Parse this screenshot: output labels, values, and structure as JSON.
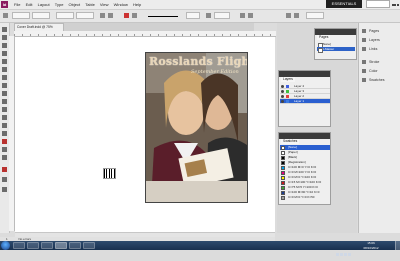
{
  "menubar": {
    "logo": "Id",
    "items": [
      "File",
      "Edit",
      "Layout",
      "Type",
      "Object",
      "Table",
      "View",
      "Window",
      "Help"
    ],
    "workspace": "ESSENTIALS",
    "search_placeholder": ""
  },
  "document": {
    "tab_label": "Cover Draft.indd @ 75%"
  },
  "cover": {
    "masthead": "Rosslands Flights",
    "issue_line": "September Edition"
  },
  "panels": {
    "pages_tab": "Pages",
    "pages": [
      "[None]",
      "A-Master"
    ],
    "layers_tab": "Layers",
    "layers": [
      {
        "name": "Layer 4",
        "color": "#3f5fe0",
        "selected": false
      },
      {
        "name": "Layer 3",
        "color": "#3fbf3f",
        "selected": false
      },
      {
        "name": "Layer 2",
        "color": "#e04040",
        "selected": false
      },
      {
        "name": "Layer 1",
        "color": "#3d7be0",
        "selected": true
      }
    ],
    "swatches_tab": "Swatches",
    "swatches": [
      {
        "name": "[None]",
        "color": "#ffffff",
        "selected": true
      },
      {
        "name": "[Paper]",
        "color": "#ffffff",
        "selected": false
      },
      {
        "name": "[Black]",
        "color": "#000000",
        "selected": false
      },
      {
        "name": "[Registration]",
        "color": "#000000",
        "selected": false
      },
      {
        "name": "C=100 M=0 Y=0 K=0",
        "color": "#00a0e9",
        "selected": false
      },
      {
        "name": "C=0 M=100 Y=0 K=0",
        "color": "#e4007f",
        "selected": false
      },
      {
        "name": "C=0 M=0 Y=100 K=0",
        "color": "#fff100",
        "selected": false
      },
      {
        "name": "C=15 M=100 Y=100 K=0",
        "color": "#c8161e",
        "selected": false
      },
      {
        "name": "C=75 M=5 Y=100 K=0",
        "color": "#3fa535",
        "selected": false
      },
      {
        "name": "C=100 M=90 Y=10 K=0",
        "color": "#1d3f8f",
        "selected": false
      },
      {
        "name": "C=0 M=0 Y=0 K=50",
        "color": "#9d9d9d",
        "selected": false
      }
    ]
  },
  "side_dock": {
    "items": [
      "Pages",
      "Layers",
      "Links",
      "Stroke",
      "Color",
      "Swatches"
    ]
  },
  "statusbar": {
    "page": "1",
    "status": "No errors"
  },
  "taskbar": {
    "time": "15:06",
    "date": "08/10/2012"
  }
}
